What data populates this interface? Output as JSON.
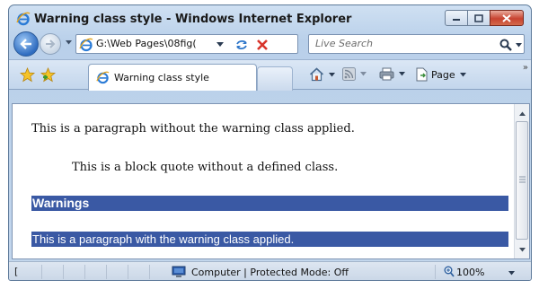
{
  "window": {
    "title": "Warning class style - Windows Internet Explorer"
  },
  "navigation": {
    "address": "G:\\Web Pages\\08fig(",
    "search_placeholder": "Live Search"
  },
  "tab": {
    "label": "Warning class style"
  },
  "command_bar": {
    "page_label": "Page"
  },
  "content": {
    "paragraph": "This is a paragraph without the warning class applied.",
    "blockquote": "This is a block quote without a defined class.",
    "warning_heading": "Warnings",
    "warning_paragraph": "This is a paragraph with the warning class applied."
  },
  "status_bar": {
    "left": "[",
    "zone": "Computer | Protected Mode: Off",
    "zoom": "100%"
  },
  "colors": {
    "warning_background": "#3a59a4",
    "warning_text": "#ffffff"
  }
}
